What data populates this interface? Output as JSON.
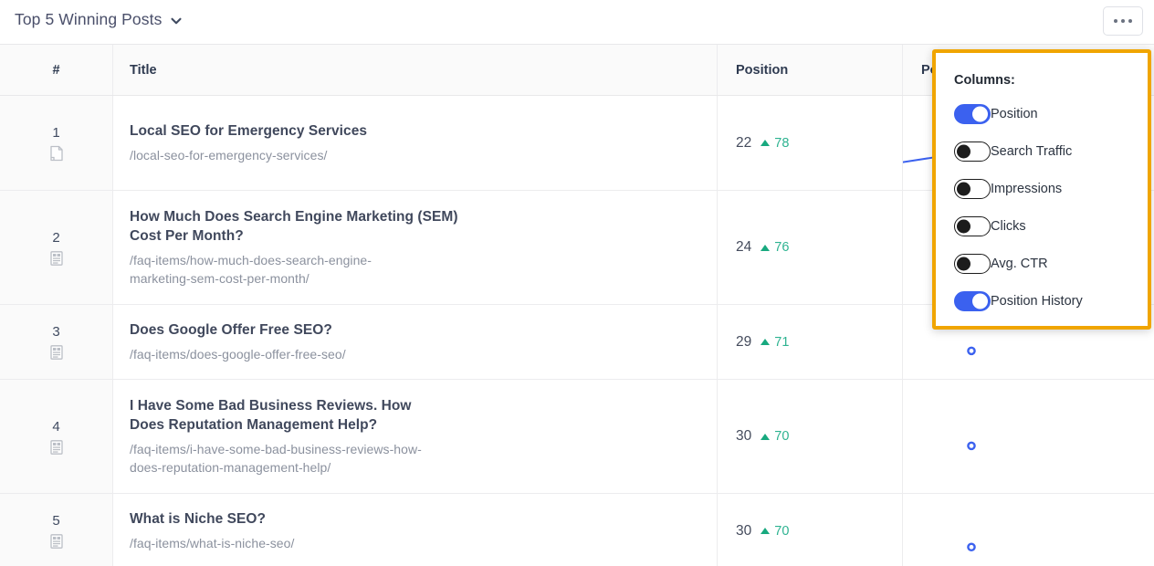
{
  "header": {
    "title": "Top 5 Winning Posts",
    "dropdown_icon": "chevron-down-icon",
    "menu_button_icon": "ellipsis-icon"
  },
  "table": {
    "columns": [
      {
        "key": "num",
        "label": "#"
      },
      {
        "key": "title",
        "label": "Title"
      },
      {
        "key": "position",
        "label": "Position"
      },
      {
        "key": "position_history",
        "label": "Po"
      }
    ],
    "rows": [
      {
        "num": "1",
        "icon": "page-icon",
        "title": "Local SEO for Emergency Services",
        "url": "/local-seo-for-emergency-services/",
        "position": "22",
        "delta": "78",
        "delta_direction": "up"
      },
      {
        "num": "2",
        "icon": "article-icon",
        "title": "How Much Does Search Engine Marketing (SEM) Cost Per Month?",
        "url": "/faq-items/how-much-does-search-engine-marketing-sem-cost-per-month/",
        "position": "24",
        "delta": "76",
        "delta_direction": "up"
      },
      {
        "num": "3",
        "icon": "article-icon",
        "title": "Does Google Offer Free SEO?",
        "url": "/faq-items/does-google-offer-free-seo/",
        "position": "29",
        "delta": "71",
        "delta_direction": "up"
      },
      {
        "num": "4",
        "icon": "article-icon",
        "title": "I Have Some Bad Business Reviews. How Does Reputation Management Help?",
        "url": "/faq-items/i-have-some-bad-business-reviews-how-does-reputation-management-help/",
        "position": "30",
        "delta": "70",
        "delta_direction": "up"
      },
      {
        "num": "5",
        "icon": "article-icon",
        "title": "What is Niche SEO?",
        "url": "/faq-items/what-is-niche-seo/",
        "position": "30",
        "delta": "70",
        "delta_direction": "up"
      }
    ]
  },
  "columns_panel": {
    "label": "Columns:",
    "border_color": "#f0a500",
    "toggle_on_color": "#3b61ef",
    "toggles": [
      {
        "label": "Position",
        "state": "on"
      },
      {
        "label": "Search Traffic",
        "state": "off"
      },
      {
        "label": "Impressions",
        "state": "off"
      },
      {
        "label": "Clicks",
        "state": "off"
      },
      {
        "label": "Avg. CTR",
        "state": "off"
      },
      {
        "label": "Position History",
        "state": "on"
      }
    ]
  },
  "colors": {
    "delta_up": "#2eb391",
    "sparkline": "#3b61ef",
    "title_text": "#40485c",
    "url_text": "#8b919e"
  }
}
